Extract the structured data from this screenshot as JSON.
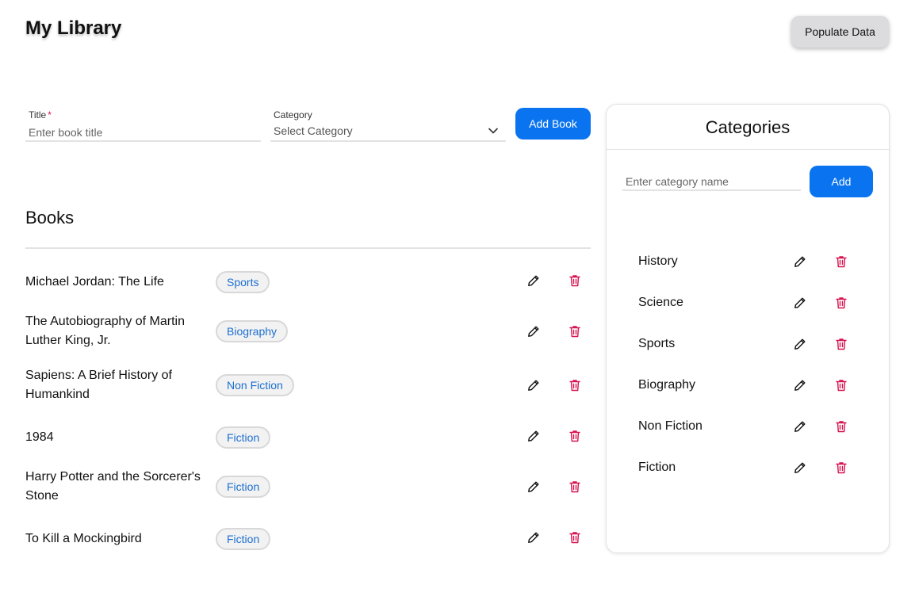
{
  "header": {
    "title": "My Library",
    "populate_label": "Populate Data"
  },
  "form": {
    "title_label": "Title",
    "required_mark": "*",
    "title_placeholder": "Enter book title",
    "category_label": "Category",
    "category_value": "Select Category",
    "add_book_label": "Add Book"
  },
  "books": {
    "heading": "Books",
    "items": [
      {
        "title": "Michael Jordan: The Life",
        "category": "Sports"
      },
      {
        "title": "The Autobiography of Martin Luther King, Jr.",
        "category": "Biography"
      },
      {
        "title": "Sapiens: A Brief History of Humankind",
        "category": "Non Fiction"
      },
      {
        "title": "1984",
        "category": "Fiction"
      },
      {
        "title": "Harry Potter and the Sorcerer's Stone",
        "category": "Fiction"
      },
      {
        "title": "To Kill a Mockingbird",
        "category": "Fiction"
      }
    ]
  },
  "categories_panel": {
    "heading": "Categories",
    "input_placeholder": "Enter category name",
    "add_label": "Add",
    "items": [
      "History",
      "Science",
      "Sports",
      "Biography",
      "Non Fiction",
      "Fiction"
    ]
  },
  "icons": {
    "edit": "pencil-icon",
    "delete": "trash-icon",
    "dropdown": "chevron-down-icon"
  },
  "colors": {
    "primary": "#0a74f0",
    "danger": "#d6124f",
    "badge_text": "#1c6fd1"
  }
}
